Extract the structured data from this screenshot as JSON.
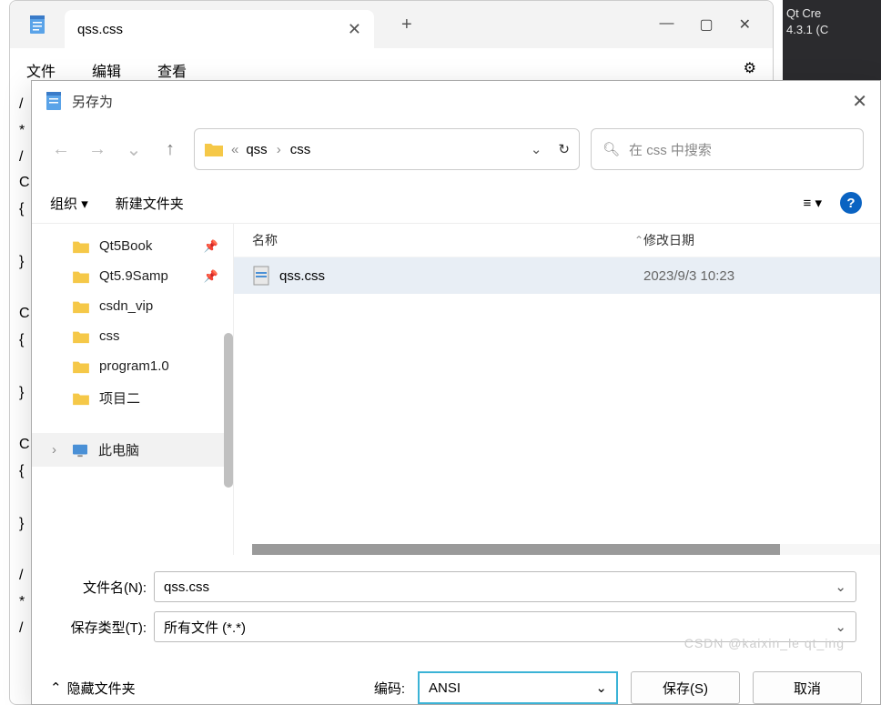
{
  "right_strip": {
    "line1": "Qt Cre",
    "line2": "4.3.1 (C"
  },
  "notepad": {
    "tab_title": "qss.css",
    "menu": {
      "file": "文件",
      "edit": "编辑",
      "view": "查看"
    }
  },
  "dialog": {
    "title": "另存为",
    "breadcrumb": {
      "prefix": "«",
      "parts": [
        "qss",
        "css"
      ]
    },
    "search_placeholder": "在 css 中搜索",
    "toolbar": {
      "organize": "组织",
      "new_folder": "新建文件夹"
    },
    "sidebar": [
      {
        "name": "Qt5Book",
        "pinned": true
      },
      {
        "name": "Qt5.9Samp",
        "pinned": true
      },
      {
        "name": "csdn_vip",
        "pinned": false
      },
      {
        "name": "css",
        "pinned": false
      },
      {
        "name": "program1.0",
        "pinned": false
      },
      {
        "name": "项目二",
        "pinned": false
      }
    ],
    "this_pc": "此电脑",
    "columns": {
      "name": "名称",
      "date": "修改日期"
    },
    "files": [
      {
        "name": "qss.css",
        "date": "2023/9/3 10:23",
        "selected": true
      }
    ],
    "filename_label": "文件名(N):",
    "filename_value": "qss.css",
    "filetype_label": "保存类型(T):",
    "filetype_value": "所有文件 (*.*)",
    "hide_folders": "隐藏文件夹",
    "encoding_label": "编码:",
    "encoding_value": "ANSI",
    "save": "保存(S)",
    "cancel": "取消"
  },
  "watermark": "CSDN @kaixin_le    qt_ing"
}
